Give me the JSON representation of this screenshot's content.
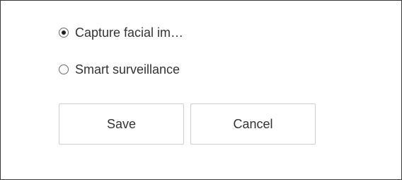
{
  "options": [
    {
      "label": "Capture facial im…",
      "checked": true
    },
    {
      "label": "Smart surveillance",
      "checked": false
    }
  ],
  "buttons": {
    "save_label": "Save",
    "cancel_label": "Cancel"
  },
  "colors": {
    "border": "#3a3a3a",
    "text": "#333333",
    "button_border": "#cfcfcf",
    "background": "#ffffff"
  }
}
